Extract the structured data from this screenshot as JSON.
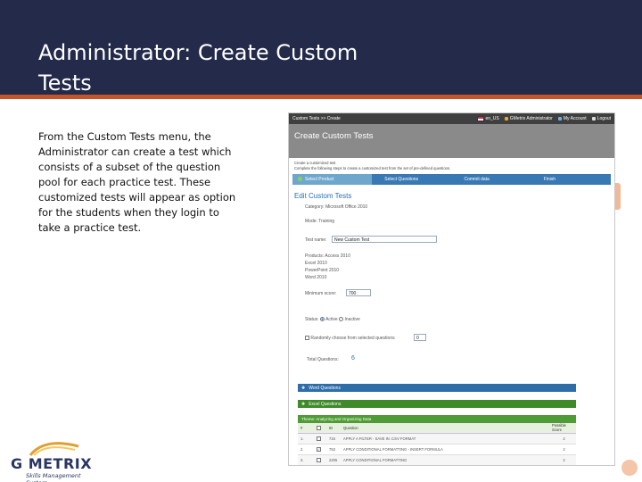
{
  "slide": {
    "title": "Administrator: Create Custom Tests",
    "body": "From the Custom Tests menu, the Administrator can create a test which consists of a subset of the question pool for each practice test.  These customized tests will appear as option for the students when they login to take a practice test.",
    "colors": {
      "header": "#232a4a",
      "accent": "#c0562a"
    }
  },
  "logo": {
    "text": "G METRIX",
    "subtitle": "Skills Management System"
  },
  "app": {
    "breadcrumb": "Custom Tests >> Create",
    "language": "en_US",
    "user": "GMetrix Administrator",
    "account_link": "My Account",
    "logout_link": "Logout",
    "page_title": "Create Custom Tests",
    "intro_line1": "Create a customized test",
    "intro_line2": "Complete the following steps to create a customized test from the set of pre-defined questions.",
    "steps": [
      "Select Product",
      "Select Questions",
      "Commit data",
      "Finish"
    ],
    "edit_title": "Edit Custom Tests",
    "category": "Category: Microsoft Office 2010",
    "mode": "Mode: Training",
    "test_name_label": "Test name:",
    "test_name_value": "New Custom Test",
    "products": [
      "Products: Access 2010",
      "Excel 2010",
      "PowerPoint 2010",
      "Word 2010"
    ],
    "min_score_label": "Minimum score:",
    "min_score_value": "700",
    "status_label": "Status:",
    "status_active": "Active",
    "status_inactive": "Inactive",
    "randomly_label": "Randomly choose from selected questions",
    "randomly_value": "0",
    "total_label": "Total Questions:",
    "total_value": "6",
    "sections": [
      "Word Questions",
      "Excel Questions"
    ],
    "theme": "Theme: Analyzing and Organizing Data",
    "table_headers": [
      "#",
      "",
      "ID",
      "Question",
      "Possible Score"
    ],
    "rows": [
      {
        "num": "1.",
        "checked": false,
        "id": "734",
        "question": "APPLY A FILTER - SAVE IN .CSV FORMAT",
        "score": "2"
      },
      {
        "num": "2.",
        "checked": true,
        "id": "753",
        "question": "APPLY CONDITIONAL FORMATTING - INSERT FORMULA",
        "score": "2"
      },
      {
        "num": "3.",
        "checked": false,
        "id": "2205",
        "question": "APPLY CONDITIONAL FORMATTING",
        "score": "2"
      }
    ]
  }
}
